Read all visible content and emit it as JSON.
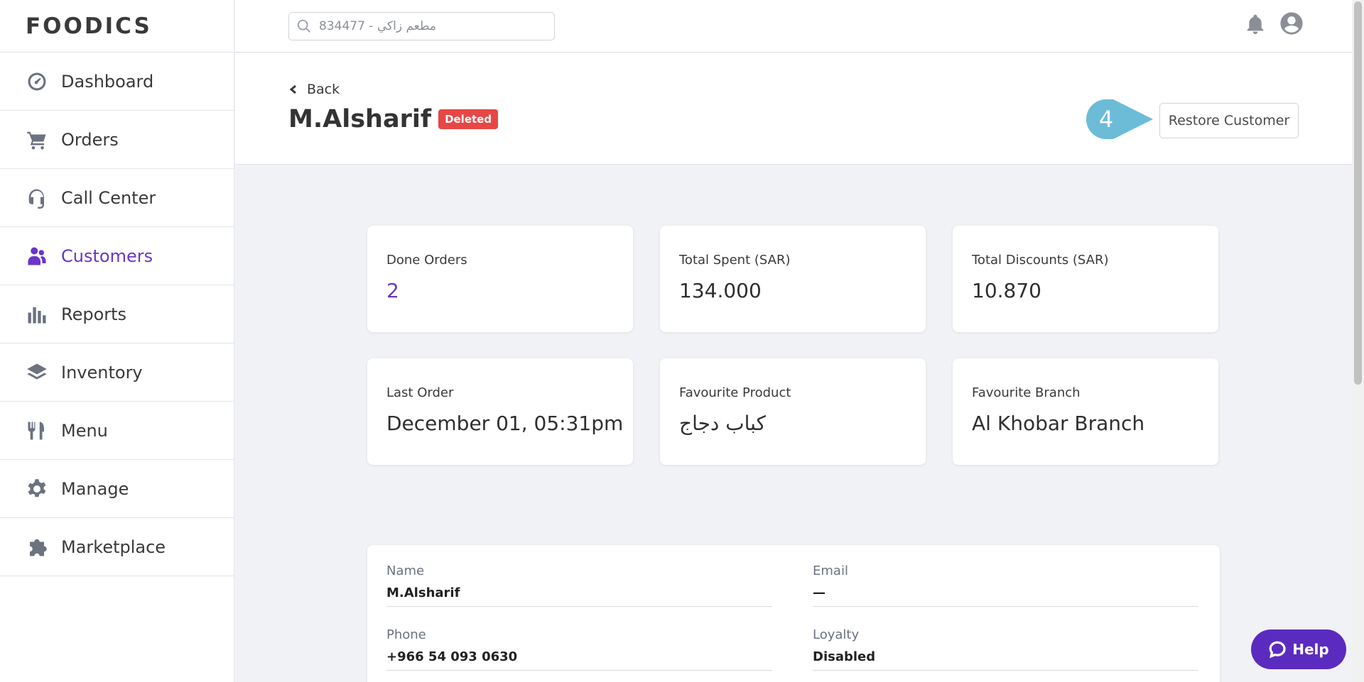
{
  "app": {
    "logo_text": "FOODICS"
  },
  "sidebar": {
    "items": [
      {
        "label": "Dashboard",
        "icon": "dashboard-gauge-icon"
      },
      {
        "label": "Orders",
        "icon": "cart-icon"
      },
      {
        "label": "Call Center",
        "icon": "headset-icon"
      },
      {
        "label": "Customers",
        "icon": "users-icon",
        "active": true
      },
      {
        "label": "Reports",
        "icon": "bar-chart-icon"
      },
      {
        "label": "Inventory",
        "icon": "layers-icon"
      },
      {
        "label": "Menu",
        "icon": "utensils-icon"
      },
      {
        "label": "Manage",
        "icon": "gear-icon"
      },
      {
        "label": "Marketplace",
        "icon": "puzzle-icon"
      }
    ]
  },
  "topbar": {
    "search_placeholder": "مطعم زاكي - 834477",
    "icons": [
      "bell-icon",
      "user-avatar-icon"
    ]
  },
  "header": {
    "back_label": "Back",
    "customer_name": "M.Alsharif",
    "status_badge": "Deleted",
    "restore_label": "Restore Customer",
    "step_marker": "4"
  },
  "stats": [
    {
      "label": "Done Orders",
      "value": "2"
    },
    {
      "label": "Total Spent (SAR)",
      "value": "134.000"
    },
    {
      "label": "Total Discounts (SAR)",
      "value": "10.870"
    },
    {
      "label": "Last Order",
      "value": "December 01, 05:31pm"
    },
    {
      "label": "Favourite Product",
      "value": "كباب دجاج"
    },
    {
      "label": "Favourite Branch",
      "value": "Al Khobar Branch"
    }
  ],
  "details": {
    "name_label": "Name",
    "name_value": "M.Alsharif",
    "email_label": "Email",
    "email_value": "—",
    "phone_label": "Phone",
    "phone_value": "+966 54 093 0630",
    "loyalty_label": "Loyalty",
    "loyalty_value": "Disabled"
  },
  "help": {
    "label": "Help"
  },
  "colors": {
    "accent": "#6a35c9",
    "danger": "#e74646",
    "help_bg": "#5b2bbf",
    "marker": "#6cbcd8"
  }
}
